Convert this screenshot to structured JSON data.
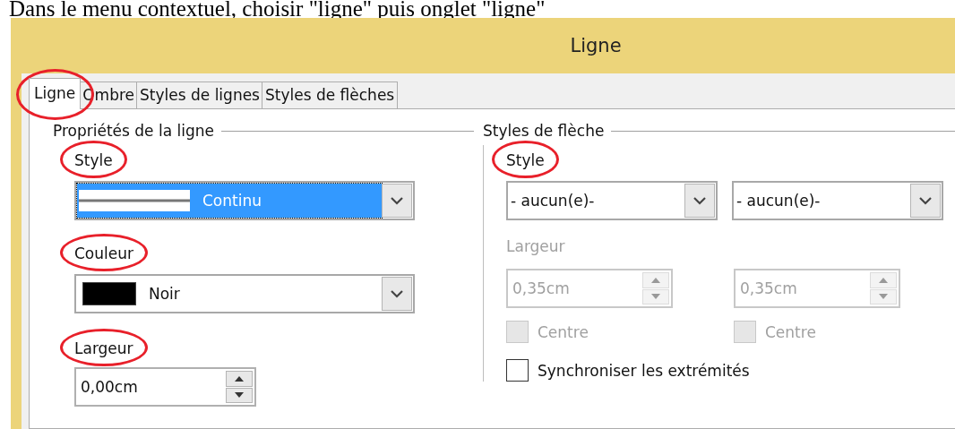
{
  "caption": "Dans le menu contextuel, choisir \"ligne\" puis onglet \"ligne\"",
  "window": {
    "title": "Ligne"
  },
  "tabs": [
    {
      "label": "Ligne",
      "selected": true,
      "circled": true
    },
    {
      "label": "Ombre",
      "selected": false,
      "circled": false
    },
    {
      "label": "Styles de lignes",
      "selected": false,
      "circled": false
    },
    {
      "label": "Styles de flèches",
      "selected": false,
      "circled": false
    }
  ],
  "line_properties": {
    "heading": "Propriétés de la ligne",
    "style": {
      "label": "Style",
      "circled": true,
      "value": "Continu",
      "focused": true
    },
    "color": {
      "label": "Couleur",
      "circled": true,
      "value": "Noir",
      "color": "#000000"
    },
    "width": {
      "label": "Largeur",
      "circled": true,
      "value": "0,00cm"
    }
  },
  "arrow_styles": {
    "heading": "Styles de flèche",
    "style": {
      "label": "Style",
      "circled": true,
      "values": [
        "- aucun(e)-",
        "- aucun(e)-"
      ]
    },
    "width": {
      "label": "Largeur",
      "disabled": true,
      "values": [
        "0,35cm",
        "0,35cm"
      ]
    },
    "center": [
      {
        "label": "Centre",
        "checked": false,
        "disabled": true
      },
      {
        "label": "Centre",
        "checked": false,
        "disabled": true
      }
    ],
    "sync": {
      "label": "Synchroniser les extrémités",
      "checked": false,
      "disabled": false
    }
  }
}
